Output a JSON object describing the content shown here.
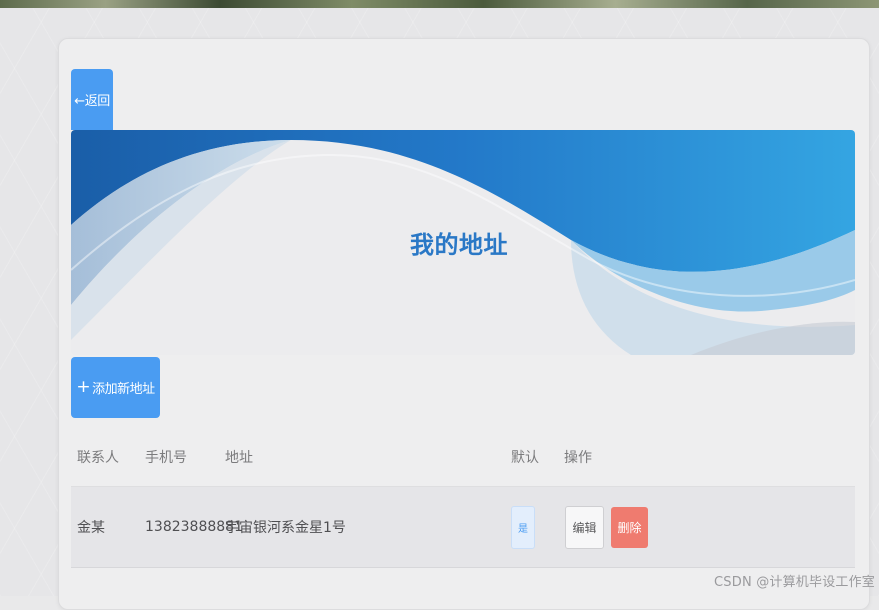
{
  "header": {
    "back_label": "←返回"
  },
  "banner": {
    "title": "我的地址"
  },
  "actions": {
    "add_label": "添加新地址"
  },
  "table": {
    "columns": {
      "contact": "联系人",
      "phone": "手机号",
      "address": "地址",
      "default": "默认",
      "operations": "操作"
    },
    "rows": [
      {
        "contact": "金某",
        "phone": "13823888881",
        "address": "宇宙银河系金星1号",
        "default": "是",
        "edit_label": "编辑",
        "delete_label": "删除"
      }
    ]
  },
  "watermark": "CSDN @计算机毕设工作室",
  "colors": {
    "primary": "#4a9cf2",
    "danger": "#ef7b6f",
    "banner_blue": "#1f6fb8",
    "title_blue": "#2a78c6"
  }
}
